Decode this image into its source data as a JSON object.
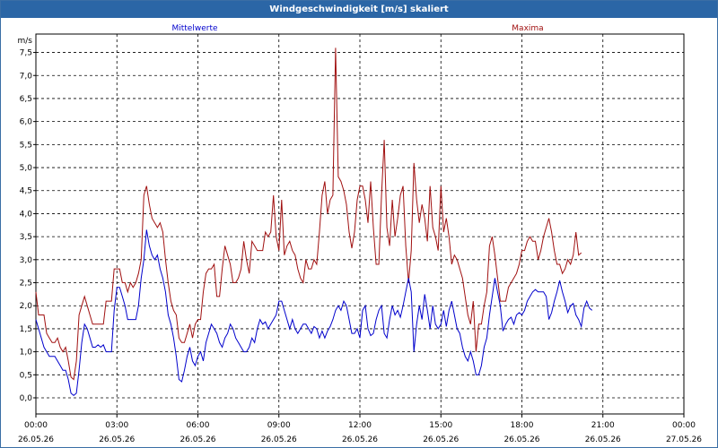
{
  "window": {
    "title": "Windgeschwindigkeit [m/s] skaliert"
  },
  "chart_data": {
    "type": "line",
    "ylabel": "m/s",
    "ylim": [
      -0.35,
      7.9
    ],
    "yticks": [
      0.0,
      0.5,
      1.0,
      1.5,
      2.0,
      2.5,
      3.0,
      3.5,
      4.0,
      4.5,
      5.0,
      5.5,
      6.0,
      6.5,
      7.0,
      7.5
    ],
    "ytick_labels": [
      "0,0",
      "0,5",
      "1,0",
      "1,5",
      "2,0",
      "2,5",
      "3,0",
      "3,5",
      "4,0",
      "4,5",
      "5,0",
      "5,5",
      "6,0",
      "6,5",
      "7,0",
      "7,5"
    ],
    "xlim_hours": [
      0,
      24
    ],
    "xticks": [
      {
        "h": 0,
        "time": "00:00",
        "date": "26.05.26"
      },
      {
        "h": 3,
        "time": "03:00",
        "date": "26.05.26"
      },
      {
        "h": 6,
        "time": "06:00",
        "date": "26.05.26"
      },
      {
        "h": 9,
        "time": "09:00",
        "date": "26.05.26"
      },
      {
        "h": 12,
        "time": "12:00",
        "date": "26.05.26"
      },
      {
        "h": 15,
        "time": "15:00",
        "date": "26.05.26"
      },
      {
        "h": 18,
        "time": "18:00",
        "date": "26.05.26"
      },
      {
        "h": 21,
        "time": "21:00",
        "date": "26.05.26"
      },
      {
        "h": 24,
        "time": "00:00",
        "date": "27.05.26"
      }
    ],
    "grid": true,
    "series": [
      {
        "name": "Mittelwerte",
        "color": "#0000cc",
        "x_step_hours": 0.1,
        "values": [
          1.7,
          1.5,
          1.3,
          1.1,
          1.0,
          0.9,
          0.9,
          0.9,
          0.8,
          0.7,
          0.6,
          0.6,
          0.4,
          0.1,
          0.05,
          0.1,
          0.6,
          1.2,
          1.6,
          1.5,
          1.3,
          1.1,
          1.1,
          1.15,
          1.1,
          1.15,
          1.0,
          1.0,
          1.0,
          1.9,
          2.4,
          2.4,
          2.2,
          2.0,
          1.7,
          1.7,
          1.7,
          1.7,
          2.0,
          2.6,
          3.0,
          3.65,
          3.3,
          3.1,
          3.0,
          3.1,
          2.8,
          2.6,
          2.3,
          1.8,
          1.6,
          1.3,
          0.9,
          0.4,
          0.35,
          0.6,
          0.9,
          1.1,
          0.8,
          0.7,
          0.9,
          1.0,
          0.8,
          1.2,
          1.4,
          1.6,
          1.5,
          1.4,
          1.2,
          1.1,
          1.3,
          1.4,
          1.6,
          1.5,
          1.3,
          1.2,
          1.1,
          1.0,
          1.0,
          1.1,
          1.3,
          1.2,
          1.5,
          1.7,
          1.6,
          1.65,
          1.5,
          1.6,
          1.7,
          1.8,
          2.1,
          2.1,
          1.9,
          1.7,
          1.5,
          1.7,
          1.5,
          1.4,
          1.5,
          1.6,
          1.6,
          1.5,
          1.4,
          1.55,
          1.5,
          1.3,
          1.45,
          1.3,
          1.45,
          1.55,
          1.7,
          1.9,
          2.0,
          1.9,
          2.1,
          2.0,
          1.7,
          1.4,
          1.4,
          1.5,
          1.3,
          1.9,
          2.0,
          1.5,
          1.35,
          1.4,
          1.7,
          1.9,
          2.0,
          1.4,
          1.3,
          1.7,
          2.0,
          1.8,
          1.9,
          1.75,
          2.0,
          2.3,
          2.6,
          2.3,
          1.0,
          1.6,
          2.0,
          1.7,
          2.25,
          1.9,
          1.5,
          2.0,
          1.6,
          1.5,
          1.6,
          1.9,
          1.55,
          1.9,
          2.1,
          1.8,
          1.5,
          1.4,
          1.1,
          0.9,
          0.8,
          1.0,
          0.8,
          0.5,
          0.5,
          0.7,
          1.1,
          1.3,
          1.8,
          2.2,
          2.6,
          2.3,
          2.0,
          1.45,
          1.6,
          1.7,
          1.75,
          1.6,
          1.8,
          1.85,
          1.8,
          1.9,
          2.1,
          2.2,
          2.3,
          2.35,
          2.3,
          2.3,
          2.3,
          2.2,
          1.7,
          1.85,
          2.1,
          2.3,
          2.55,
          2.3,
          2.1,
          1.85,
          2.0,
          2.05,
          1.8,
          1.7,
          1.55,
          1.95,
          2.1,
          1.95,
          1.9
        ]
      },
      {
        "name": "Maxima",
        "color": "#a01010",
        "x_step_hours": 0.1,
        "values": [
          2.3,
          1.8,
          1.8,
          1.8,
          1.4,
          1.3,
          1.2,
          1.2,
          1.3,
          1.1,
          1.0,
          1.1,
          0.8,
          0.45,
          0.4,
          0.8,
          1.8,
          2.0,
          2.2,
          2.0,
          1.8,
          1.6,
          1.6,
          1.6,
          1.6,
          1.6,
          2.1,
          2.1,
          2.1,
          2.8,
          2.8,
          2.8,
          2.5,
          2.5,
          2.3,
          2.5,
          2.4,
          2.5,
          2.7,
          3.0,
          4.4,
          4.6,
          4.2,
          3.9,
          3.8,
          3.7,
          3.8,
          3.6,
          3.0,
          2.5,
          2.1,
          1.9,
          1.8,
          1.3,
          1.2,
          1.2,
          1.4,
          1.6,
          1.3,
          1.6,
          1.7,
          1.7,
          2.3,
          2.7,
          2.8,
          2.8,
          2.9,
          2.2,
          2.2,
          2.8,
          3.3,
          3.1,
          2.9,
          2.5,
          2.5,
          2.6,
          2.8,
          3.4,
          3.0,
          2.7,
          3.4,
          3.3,
          3.2,
          3.2,
          3.2,
          3.6,
          3.5,
          3.6,
          4.4,
          3.5,
          3.2,
          4.3,
          3.1,
          3.3,
          3.4,
          3.2,
          3.1,
          2.8,
          2.6,
          2.5,
          3.0,
          2.8,
          2.8,
          3.0,
          2.9,
          3.6,
          4.4,
          4.7,
          4.0,
          4.3,
          4.4,
          7.6,
          4.8,
          4.7,
          4.5,
          4.2,
          3.6,
          3.25,
          3.6,
          4.3,
          4.6,
          4.6,
          4.3,
          3.8,
          4.7,
          3.7,
          2.9,
          2.9,
          4.4,
          5.6,
          3.7,
          3.3,
          4.3,
          3.5,
          3.9,
          4.4,
          4.6,
          3.3,
          2.5,
          3.2,
          5.1,
          4.3,
          3.8,
          4.2,
          3.9,
          3.4,
          4.6,
          3.7,
          3.5,
          3.2,
          4.6,
          3.6,
          3.9,
          3.5,
          2.9,
          3.1,
          3.0,
          2.8,
          2.6,
          2.2,
          1.8,
          1.6,
          2.1,
          1.0,
          1.6,
          1.6,
          2.0,
          2.3,
          3.3,
          3.5,
          3.1,
          2.6,
          2.1,
          2.1,
          2.1,
          2.4,
          2.5,
          2.6,
          2.7,
          2.9,
          3.2,
          3.2,
          3.4,
          3.5,
          3.4,
          3.4,
          3.0,
          3.2,
          3.5,
          3.7,
          3.9,
          3.6,
          3.2,
          2.9,
          2.9,
          2.7,
          2.8,
          3.0,
          2.9,
          3.1,
          3.6,
          3.1,
          3.15
        ]
      }
    ]
  }
}
